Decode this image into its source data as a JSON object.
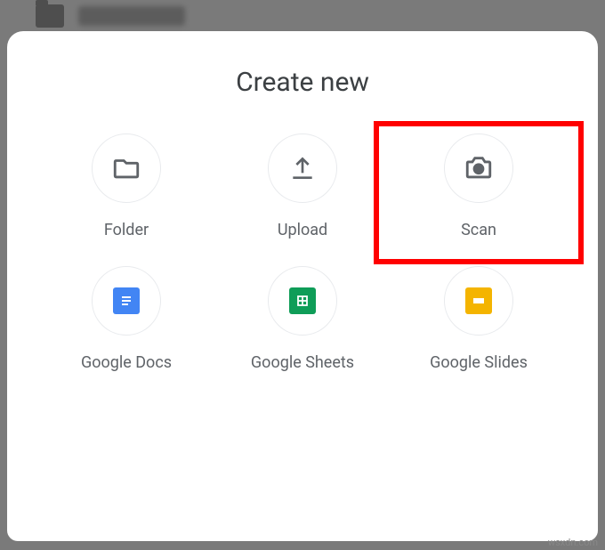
{
  "modal": {
    "title": "Create new",
    "options": [
      {
        "id": "folder",
        "label": "Folder"
      },
      {
        "id": "upload",
        "label": "Upload"
      },
      {
        "id": "scan",
        "label": "Scan",
        "highlighted": true
      },
      {
        "id": "docs",
        "label": "Google Docs"
      },
      {
        "id": "sheets",
        "label": "Google Sheets"
      },
      {
        "id": "slides",
        "label": "Google Slides"
      }
    ]
  },
  "watermark": "wsxdn.com"
}
